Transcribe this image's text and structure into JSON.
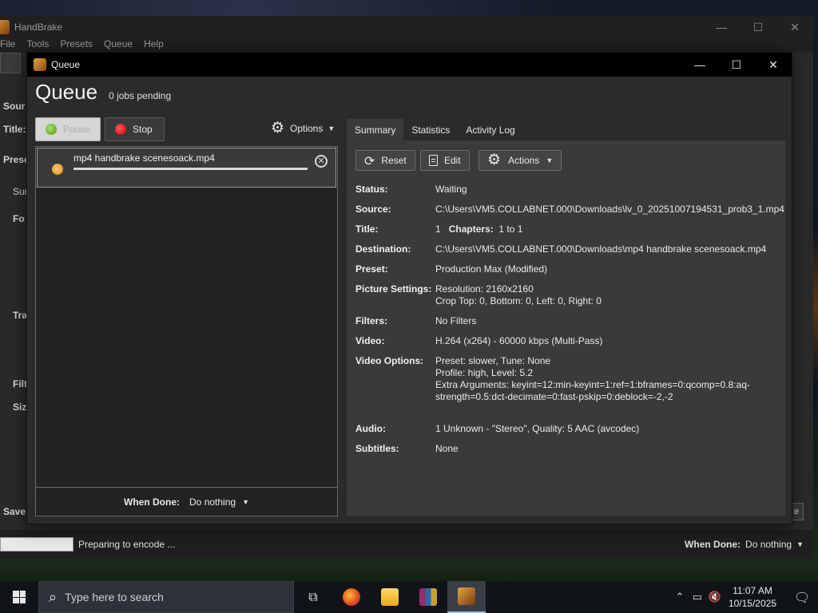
{
  "main_window": {
    "title": "HandBrake",
    "menu": [
      "File",
      "Tools",
      "Presets",
      "Queue",
      "Help"
    ],
    "side_labels": [
      "Sour",
      "Title:",
      "Prese",
      "Sur",
      "Fo",
      "Tra",
      "Filt",
      "Siz"
    ],
    "save_label": "Save",
    "right_btn_label": "e",
    "status_text": "Preparing to encode ...",
    "when_done_label": "When Done:",
    "when_done_value": "Do nothing"
  },
  "queue_window": {
    "title": "Queue",
    "heading": "Queue",
    "pending": "0 jobs pending",
    "pause_label": "Pause",
    "stop_label": "Stop",
    "options_label": "Options",
    "item": {
      "name": "mp4 handbrake scenesoack.mp4"
    },
    "when_done_label": "When Done:",
    "when_done_value": "Do nothing",
    "tabs": [
      "Summary",
      "Statistics",
      "Activity Log"
    ],
    "active_tab": "Summary",
    "buttons": {
      "reset": "Reset",
      "edit": "Edit",
      "actions": "Actions"
    },
    "details": {
      "status_label": "Status:",
      "status": "Waiting",
      "source_label": "Source:",
      "source": "C:\\Users\\VM5.COLLABNET.000\\Downloads\\lv_0_20251007194531_prob3_1.mp4",
      "title_label": "Title:",
      "title_num": "1",
      "chapters_label": "Chapters:",
      "chapters": "1  to  1",
      "destination_label": "Destination:",
      "destination": "C:\\Users\\VM5.COLLABNET.000\\Downloads\\mp4 handbrake scenesoack.mp4",
      "preset_label": "Preset:",
      "preset": "Production Max (Modified)",
      "picture_label": "Picture Settings:",
      "picture_1": "Resolution: 2160x2160",
      "picture_2": "Crop Top: 0, Bottom: 0, Left: 0, Right: 0",
      "filters_label": "Filters:",
      "filters": "No Filters",
      "video_label": "Video:",
      "video": "H.264 (x264) - 60000  kbps (Multi-Pass)",
      "video_options_label": "Video Options:",
      "video_options_1": "Preset: slower, Tune: None",
      "video_options_2": "Profile: high, Level: 5.2",
      "video_options_3": "Extra Arguments: keyint=12:min-keyint=1:ref=1:bframes=0:qcomp=0.8:aq-strength=0.5:dct-decimate=0:fast-pskip=0:deblock=-2,-2",
      "audio_label": "Audio:",
      "audio": "1 Unknown - \"Stereo\", Quality:  5 AAC (avcodec)",
      "subtitles_label": "Subtitles:",
      "subtitles": "None"
    }
  },
  "taskbar": {
    "search_placeholder": "Type here to search",
    "time": "11:07 AM",
    "date": "10/15/2025"
  }
}
